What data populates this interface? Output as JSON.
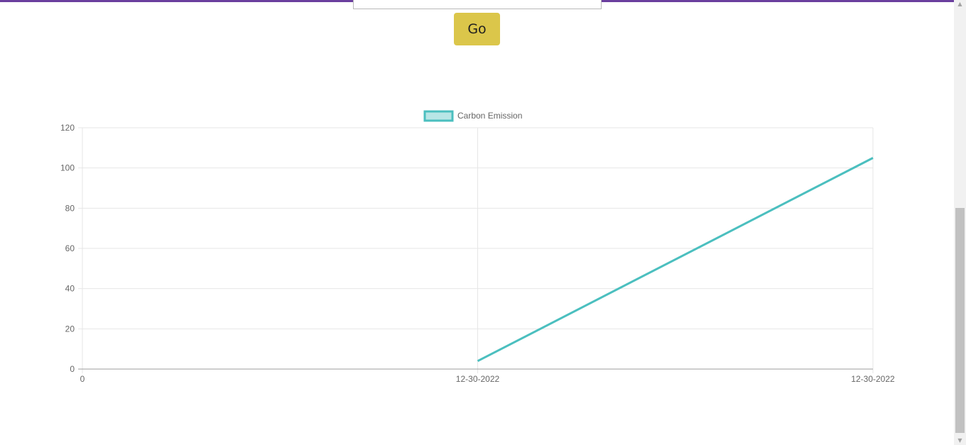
{
  "search": {
    "value": ""
  },
  "go_button": {
    "label": "Go"
  },
  "colors": {
    "top_bar": "#6a3f9e",
    "button": "#dbc64a",
    "series_line": "#4bbfbf",
    "series_fill": "#b8e6e6",
    "grid": "#e6e6e6",
    "axis": "#9e9e9e",
    "tick_text": "#666666"
  },
  "chart_data": {
    "type": "line",
    "title": "",
    "xlabel": "",
    "ylabel": "",
    "x_tick_labels": [
      "0",
      "12-30-2022",
      "12-30-2022"
    ],
    "y_tick_labels": [
      "0",
      "20",
      "40",
      "60",
      "80",
      "100",
      "120"
    ],
    "ylim": [
      0,
      120
    ],
    "grid": true,
    "legend_position": "top-center",
    "series": [
      {
        "name": "Carbon Emission",
        "points": [
          {
            "x_index": 1,
            "x": "12-30-2022",
            "y": 4
          },
          {
            "x_index": 2,
            "x": "12-30-2022",
            "y": 105
          }
        ]
      }
    ]
  }
}
